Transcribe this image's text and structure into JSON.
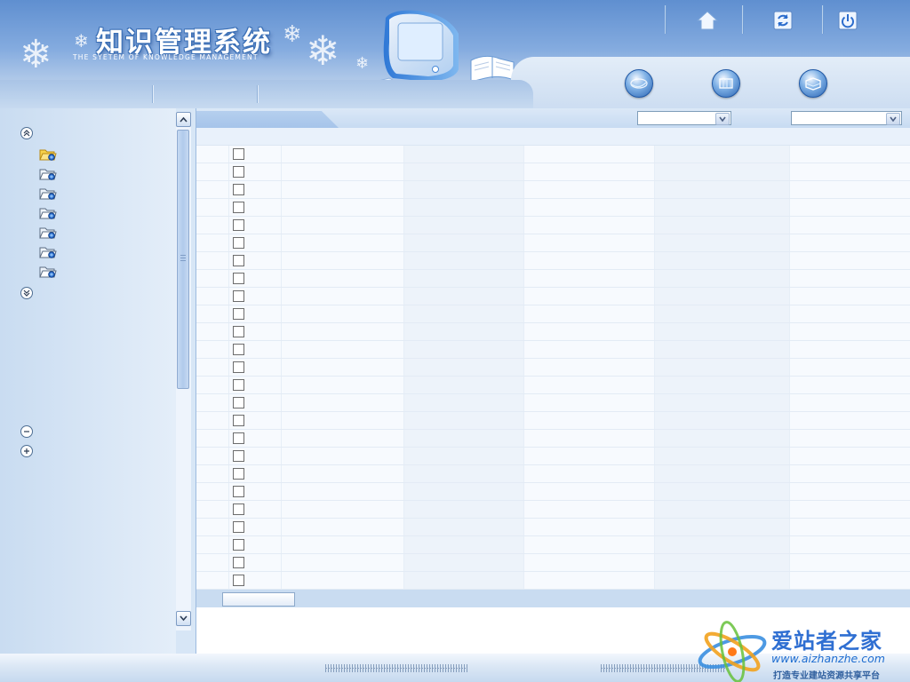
{
  "header": {
    "title": "知识管理系统",
    "subtitle": "THE SYETEM OF KNOWLEDGE MANAGEMENT",
    "top_buttons": [
      {
        "icon": "home-icon"
      },
      {
        "icon": "refresh-icon"
      },
      {
        "icon": "logout-icon"
      }
    ],
    "nav_orbs": [
      {
        "icon": "globe-icon"
      },
      {
        "icon": "grid-icon"
      },
      {
        "icon": "book-icon"
      }
    ]
  },
  "sidebar": {
    "folder_count": 7,
    "selected_folder_index": 0
  },
  "main": {
    "filters": [
      {
        "value": ""
      },
      {
        "value": ""
      }
    ],
    "row_count": 25
  },
  "watermark": {
    "name": "爱站者之家",
    "url": "www.aizhanzhe.com",
    "slogan": "打造专业建站资源共享平台"
  },
  "colors": {
    "header_blue": "#6f9ad6",
    "panel_blue": "#d7e6f6",
    "accent": "#2f6fd2"
  }
}
